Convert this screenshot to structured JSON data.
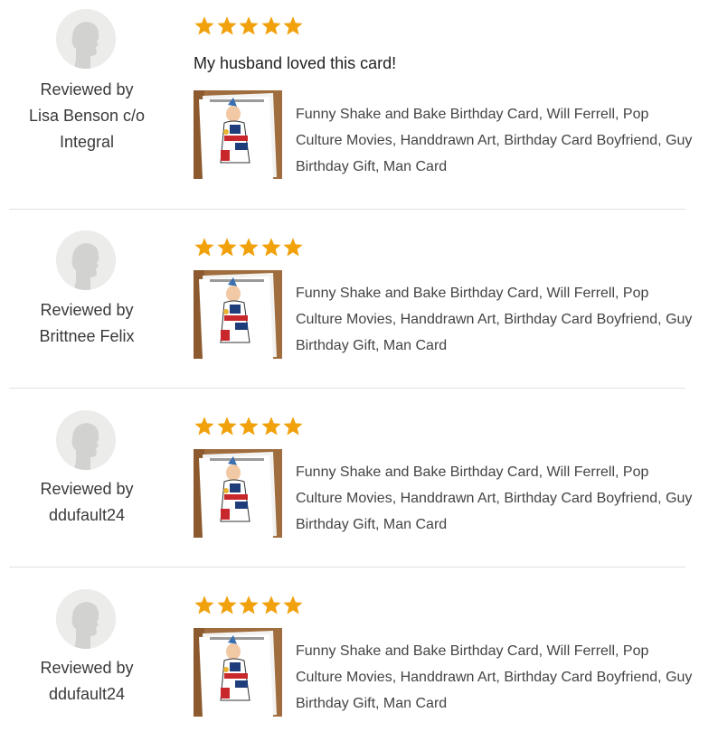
{
  "colors": {
    "star": "#F1A10B",
    "divider": "#e1e1e1",
    "avatar_bg": "#ececea",
    "text": "#222222"
  },
  "reviews": [
    {
      "reviewer_line1": "Reviewed by",
      "reviewer_line2": "Lisa Benson c/o",
      "reviewer_line3": "Integral",
      "rating": 5,
      "comment": "My husband loved this card!",
      "listing_title": "Funny Shake and Bake Birthday Card, Will Ferrell, Pop Culture Movies, Handdrawn Art, Birthday Card Boyfriend, Guy Birthday Gift, Man Card",
      "avatar_icon": "user-placeholder-icon",
      "star_icon": "star-icon"
    },
    {
      "reviewer_line1": "Reviewed by",
      "reviewer_line2": "Brittnee Felix",
      "rating": 5,
      "listing_title": "Funny Shake and Bake Birthday Card, Will Ferrell, Pop Culture Movies, Handdrawn Art, Birthday Card Boyfriend, Guy Birthday Gift, Man Card",
      "avatar_icon": "user-placeholder-icon",
      "star_icon": "star-icon"
    },
    {
      "reviewer_line1": "Reviewed by",
      "reviewer_line2": "ddufault24",
      "rating": 5,
      "listing_title": "Funny Shake and Bake Birthday Card, Will Ferrell, Pop Culture Movies, Handdrawn Art, Birthday Card Boyfriend, Guy Birthday Gift, Man Card",
      "avatar_icon": "user-placeholder-icon",
      "star_icon": "star-icon"
    },
    {
      "reviewer_line1": "Reviewed by",
      "reviewer_line2": "ddufault24",
      "rating": 5,
      "listing_title": "Funny Shake and Bake Birthday Card, Will Ferrell, Pop Culture Movies, Handdrawn Art, Birthday Card Boyfriend, Guy Birthday Gift, Man Card",
      "avatar_icon": "user-placeholder-icon",
      "star_icon": "star-icon"
    }
  ]
}
